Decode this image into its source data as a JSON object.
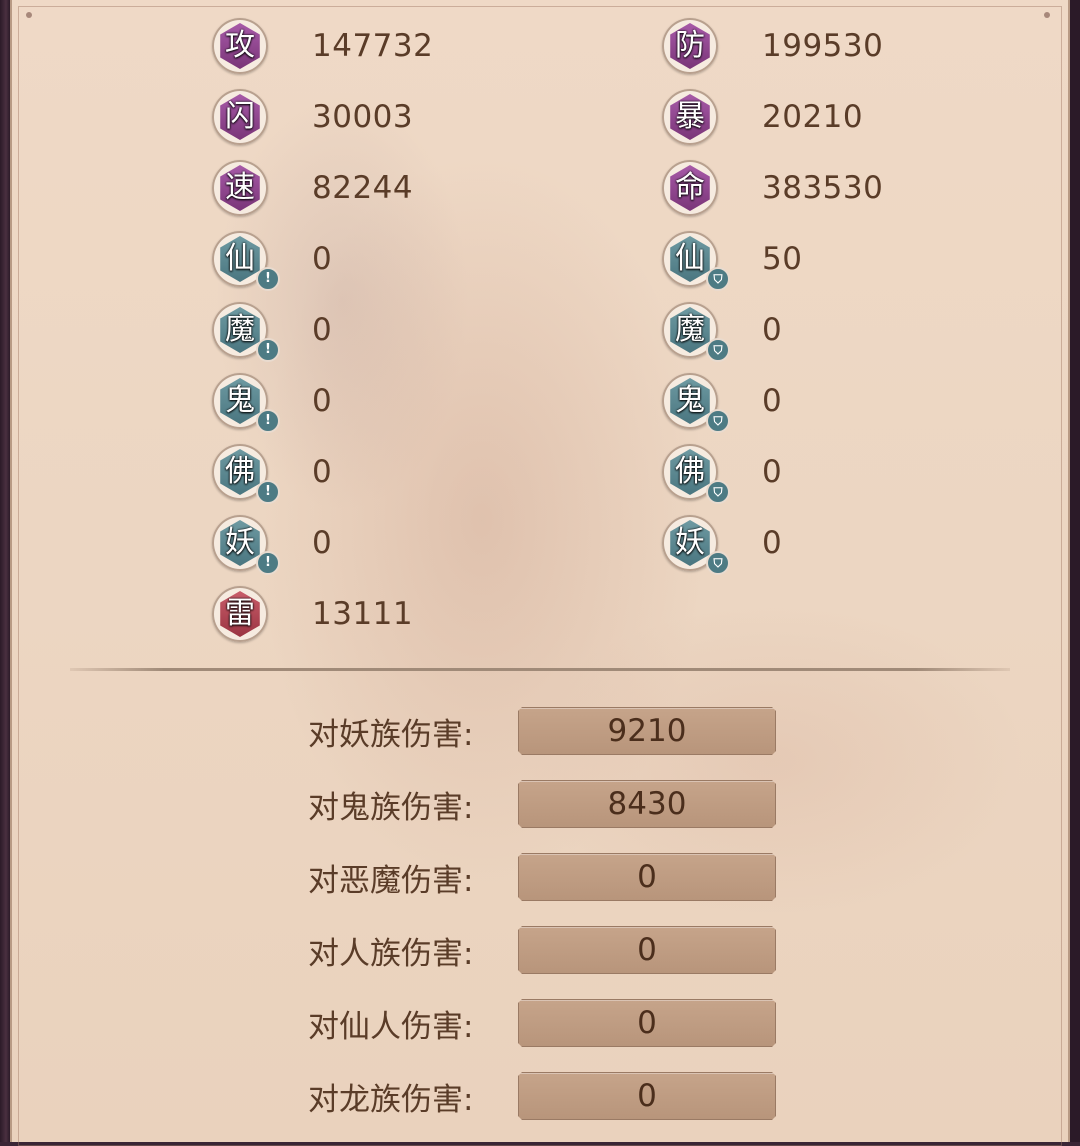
{
  "stats_left": [
    {
      "glyph": "攻",
      "value": "147732",
      "style": "purple",
      "mark": ""
    },
    {
      "glyph": "闪",
      "value": "30003",
      "style": "purple",
      "mark": ""
    },
    {
      "glyph": "速",
      "value": "82244",
      "style": "purple",
      "mark": ""
    },
    {
      "glyph": "仙",
      "value": "0",
      "style": "teal",
      "mark": "!"
    },
    {
      "glyph": "魔",
      "value": "0",
      "style": "teal",
      "mark": "!"
    },
    {
      "glyph": "鬼",
      "value": "0",
      "style": "teal",
      "mark": "!"
    },
    {
      "glyph": "佛",
      "value": "0",
      "style": "teal",
      "mark": "!"
    },
    {
      "glyph": "妖",
      "value": "0",
      "style": "teal",
      "mark": "!"
    },
    {
      "glyph": "雷",
      "value": "13111",
      "style": "red",
      "mark": ""
    }
  ],
  "stats_right": [
    {
      "glyph": "防",
      "value": "199530",
      "style": "purple",
      "mark": ""
    },
    {
      "glyph": "暴",
      "value": "20210",
      "style": "purple",
      "mark": ""
    },
    {
      "glyph": "命",
      "value": "383530",
      "style": "purple",
      "mark": ""
    },
    {
      "glyph": "仙",
      "value": "50",
      "style": "teal",
      "mark": "shield"
    },
    {
      "glyph": "魔",
      "value": "0",
      "style": "teal",
      "mark": "shield"
    },
    {
      "glyph": "鬼",
      "value": "0",
      "style": "teal",
      "mark": "shield"
    },
    {
      "glyph": "佛",
      "value": "0",
      "style": "teal",
      "mark": "shield"
    },
    {
      "glyph": "妖",
      "value": "0",
      "style": "teal",
      "mark": "shield"
    }
  ],
  "damage": [
    {
      "label": "对妖族伤害:",
      "value": "9210"
    },
    {
      "label": "对鬼族伤害:",
      "value": "8430"
    },
    {
      "label": "对恶魔伤害:",
      "value": "0"
    },
    {
      "label": "对人族伤害:",
      "value": "0"
    },
    {
      "label": "对仙人伤害:",
      "value": "0"
    },
    {
      "label": "对龙族伤害:",
      "value": "0"
    }
  ],
  "colors": {
    "panel": "#ecd6c2",
    "text": "#5a3c28",
    "purple": "#8e4490",
    "teal": "#5a8890",
    "red": "#b04555",
    "value_box": "#bf9d83"
  },
  "icons": {
    "resist_mark": "exclamation-icon",
    "defense_mark": "shield-icon"
  }
}
